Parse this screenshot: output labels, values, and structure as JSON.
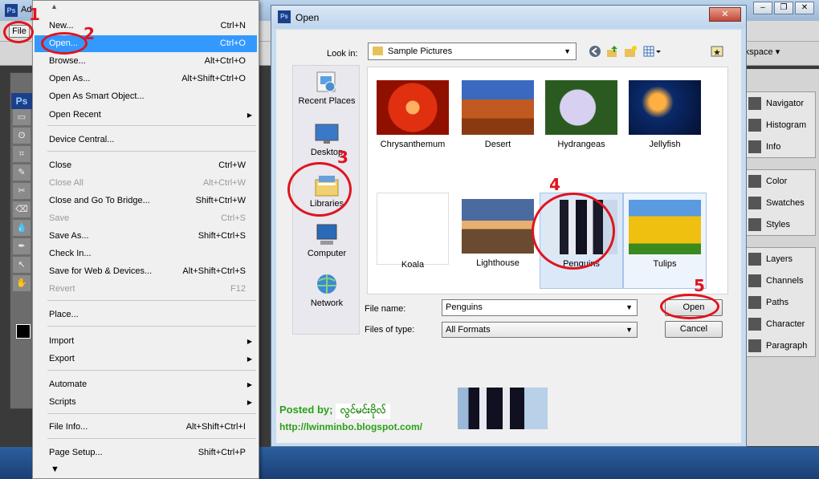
{
  "app": {
    "title": "Ad",
    "logo": "Ps",
    "file_menu_label": "File",
    "workspace_label": "orkspace ▾",
    "window_buttons": [
      "–",
      "❐",
      "✕"
    ],
    "toolbox_tools": [
      "▭",
      "ʘ",
      "⌗",
      "✎",
      "✂",
      "⌫",
      "💧",
      "✒",
      "↖",
      "✋"
    ]
  },
  "file_menu": {
    "items": [
      {
        "label": "New...",
        "shortcut": "Ctrl+N"
      },
      {
        "label": "Open...",
        "shortcut": "Ctrl+O",
        "highlight": true
      },
      {
        "label": "Browse...",
        "shortcut": "Alt+Ctrl+O"
      },
      {
        "label": "Open As...",
        "shortcut": "Alt+Shift+Ctrl+O"
      },
      {
        "label": "Open As Smart Object...",
        "shortcut": ""
      },
      {
        "label": "Open Recent",
        "shortcut": "",
        "submenu": true
      },
      {
        "label": "Device Central...",
        "shortcut": ""
      },
      {
        "label": "Close",
        "shortcut": "Ctrl+W"
      },
      {
        "label": "Close All",
        "shortcut": "Alt+Ctrl+W",
        "disabled": true
      },
      {
        "label": "Close and Go To Bridge...",
        "shortcut": "Shift+Ctrl+W"
      },
      {
        "label": "Save",
        "shortcut": "Ctrl+S",
        "disabled": true
      },
      {
        "label": "Save As...",
        "shortcut": "Shift+Ctrl+S"
      },
      {
        "label": "Check In...",
        "shortcut": ""
      },
      {
        "label": "Save for Web & Devices...",
        "shortcut": "Alt+Shift+Ctrl+S"
      },
      {
        "label": "Revert",
        "shortcut": "F12",
        "disabled": true
      },
      {
        "label": "Place...",
        "shortcut": ""
      },
      {
        "label": "Import",
        "shortcut": "",
        "submenu": true
      },
      {
        "label": "Export",
        "shortcut": "",
        "submenu": true
      },
      {
        "label": "Automate",
        "shortcut": "",
        "submenu": true
      },
      {
        "label": "Scripts",
        "shortcut": "",
        "submenu": true
      },
      {
        "label": "File Info...",
        "shortcut": "Alt+Shift+Ctrl+I"
      },
      {
        "label": "Page Setup...",
        "shortcut": "Shift+Ctrl+P"
      }
    ]
  },
  "open_dialog": {
    "title": "Open",
    "close_glyph": "✕",
    "look_in_label": "Look in:",
    "look_in_value": "Sample Pictures",
    "places": [
      {
        "label": "Recent Places",
        "icon": "recent-places-icon"
      },
      {
        "label": "Desktop",
        "icon": "desktop-icon"
      },
      {
        "label": "Libraries",
        "icon": "libraries-icon"
      },
      {
        "label": "Computer",
        "icon": "computer-icon"
      },
      {
        "label": "Network",
        "icon": "network-icon"
      }
    ],
    "files": [
      {
        "name": "Chrysanthemum"
      },
      {
        "name": "Desert"
      },
      {
        "name": "Hydrangeas"
      },
      {
        "name": "Jellyfish"
      },
      {
        "name": "Koala"
      },
      {
        "name": "Lighthouse"
      },
      {
        "name": "Penguins",
        "selected": true
      },
      {
        "name": "Tulips"
      }
    ],
    "file_name_label": "File name:",
    "file_name_value": "Penguins",
    "file_type_label": "Files of type:",
    "file_type_value": "All Formats",
    "open_button": "Open",
    "cancel_button": "Cancel"
  },
  "right_panels": {
    "group1": [
      "Navigator",
      "Histogram",
      "Info"
    ],
    "group2": [
      "Color",
      "Swatches",
      "Styles"
    ],
    "group3": [
      "Layers",
      "Channels",
      "Paths",
      "Character",
      "Paragraph"
    ]
  },
  "annotations": [
    "1",
    "2",
    "3",
    "4",
    "5"
  ],
  "watermark": {
    "posted_by": "Posted by;",
    "author": "လွင်မင်းဗိုလ်",
    "url": "http://lwinminbo.blogspot.com/"
  }
}
